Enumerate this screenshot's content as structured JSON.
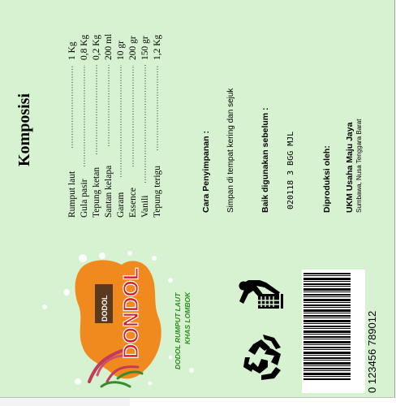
{
  "title": "Komposisi",
  "ingredients": [
    {
      "name": "Rumput laut",
      "qty": "1 Kg"
    },
    {
      "name": "Gula pasir",
      "qty": "0,8 Kg"
    },
    {
      "name": "Tepung ketan",
      "qty": "0,2 Kg"
    },
    {
      "name": "Santan kelapa",
      "qty": "200 ml"
    },
    {
      "name": "Garam",
      "qty": "10 gr"
    },
    {
      "name": "Essence",
      "qty": "200 gr"
    },
    {
      "name": "Vanili",
      "qty": "150 gr"
    },
    {
      "name": "Tepung terigu",
      "qty": "1,2 Kg"
    }
  ],
  "storage": {
    "heading": "Cara Penyimpanan :",
    "text": "Simpan di tempat kering dan sejuk"
  },
  "best_before": {
    "heading": "Baik digunakan sebelum :",
    "code": "020118 3 BGG MJL"
  },
  "producer": {
    "heading": "Diproduksi oleh:",
    "name": "UKM Usaha Maju Jaya",
    "address": "Sumbawa, Nusa Tenggara Barat"
  },
  "brand": {
    "small": "DODOL",
    "big": "DONDOL",
    "tagline1": "DODOL RUMPUT LAUT",
    "tagline2": "KHAS LOMBOK"
  },
  "barcode": {
    "number": "0   123456   789012"
  },
  "colors": {
    "panel": "#d6f2d0",
    "brand_red": "#d81a2a",
    "brand_orange": "#f08a1e",
    "tagline_green": "#2e8b22"
  }
}
